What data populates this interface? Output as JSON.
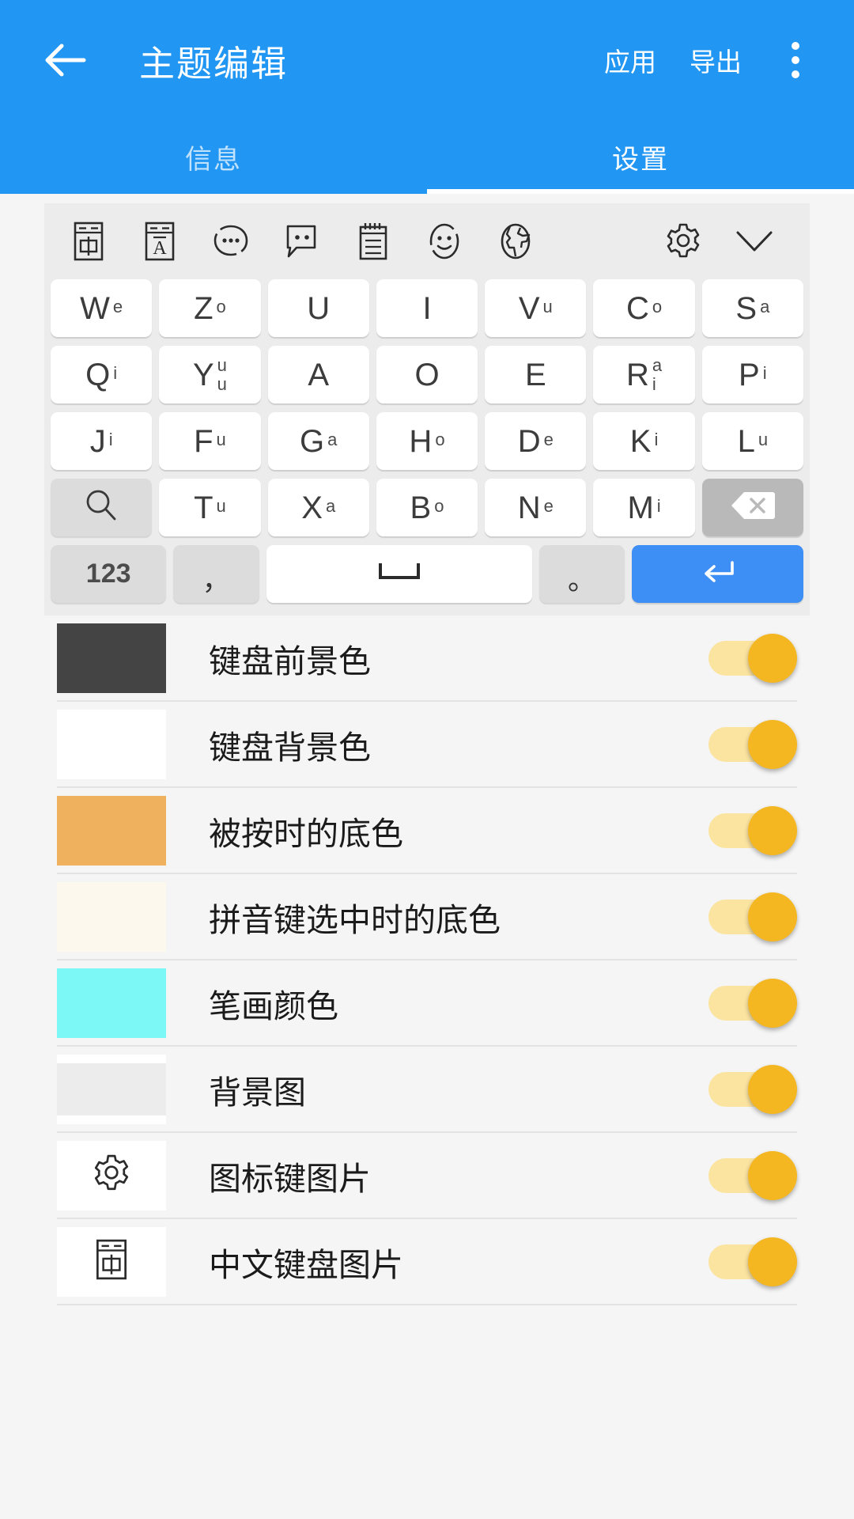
{
  "appbar": {
    "back_icon": "arrow-left-icon",
    "title": "主题编辑",
    "actions": [
      "应用",
      "导出"
    ],
    "apply_label": "应用",
    "export_label": "导出",
    "overflow_icon": "more-vertical-icon",
    "accent_color": "#2196f3"
  },
  "tabs": [
    {
      "label": "信息",
      "active": false
    },
    {
      "label": "设置",
      "active": true
    }
  ],
  "keyboard": {
    "toolbar_left": [
      "chinese-input-icon",
      "latin-input-icon",
      "candidate-bubble-icon",
      "speech-bubble-icon",
      "clipboard-icon",
      "emoji-icon",
      "globe-icon"
    ],
    "toolbar_right": [
      "gear-icon",
      "chevron-down-icon"
    ],
    "rows": [
      [
        {
          "main": "W",
          "sup": [
            "e"
          ]
        },
        {
          "main": "Z",
          "sup": [
            "o"
          ]
        },
        {
          "main": "U",
          "sup": []
        },
        {
          "main": "I",
          "sup": []
        },
        {
          "main": "V",
          "sup": [
            "u"
          ]
        },
        {
          "main": "C",
          "sup": [
            "o"
          ]
        },
        {
          "main": "S",
          "sup": [
            "a"
          ]
        }
      ],
      [
        {
          "main": "Q",
          "sup": [
            "i"
          ]
        },
        {
          "main": "Y",
          "sup": [
            "u",
            "u"
          ]
        },
        {
          "main": "A",
          "sup": []
        },
        {
          "main": "O",
          "sup": []
        },
        {
          "main": "E",
          "sup": []
        },
        {
          "main": "R",
          "sup": [
            "a",
            "i"
          ]
        },
        {
          "main": "P",
          "sup": [
            "i"
          ]
        }
      ],
      [
        {
          "main": "J",
          "sup": [
            "i"
          ]
        },
        {
          "main": "F",
          "sup": [
            "u"
          ]
        },
        {
          "main": "G",
          "sup": [
            "a"
          ]
        },
        {
          "main": "H",
          "sup": [
            "o"
          ]
        },
        {
          "main": "D",
          "sup": [
            "e"
          ]
        },
        {
          "main": "K",
          "sup": [
            "i"
          ]
        },
        {
          "main": "L",
          "sup": [
            "u"
          ]
        }
      ],
      [
        {
          "main": "",
          "sup": [],
          "icon": "search-icon",
          "style": "fn"
        },
        {
          "main": "T",
          "sup": [
            "u"
          ]
        },
        {
          "main": "X",
          "sup": [
            "a"
          ]
        },
        {
          "main": "B",
          "sup": [
            "o"
          ]
        },
        {
          "main": "N",
          "sup": [
            "e"
          ]
        },
        {
          "main": "M",
          "sup": [
            "i"
          ]
        },
        {
          "main": "",
          "sup": [],
          "icon": "backspace-icon",
          "style": "del"
        }
      ]
    ],
    "bottom_row": {
      "num_label": "123",
      "comma_label": "，",
      "space_icon": "space-bar-icon",
      "period_label": "。",
      "enter_icon": "enter-icon"
    }
  },
  "settings": {
    "rows": [
      {
        "label": "键盘前景色",
        "swatch_type": "color",
        "color": "#444444",
        "toggle_on": true
      },
      {
        "label": "键盘背景色",
        "swatch_type": "color",
        "color": "#ffffff",
        "toggle_on": true
      },
      {
        "label": "被按时的底色",
        "swatch_type": "color",
        "color": "#f0b15e",
        "toggle_on": true
      },
      {
        "label": "拼音键选中时的底色",
        "swatch_type": "color",
        "color": "#fdf8ed",
        "toggle_on": true
      },
      {
        "label": "笔画颜色",
        "swatch_type": "color",
        "color": "#7cf9f6",
        "toggle_on": true
      },
      {
        "label": "背景图",
        "swatch_type": "bgimage",
        "color": "#ececec",
        "toggle_on": true
      },
      {
        "label": "图标键图片",
        "swatch_type": "icon",
        "icon": "gear-icon",
        "toggle_on": true
      },
      {
        "label": "中文键盘图片",
        "swatch_type": "icon",
        "icon": "chinese-input-icon",
        "toggle_on": true
      }
    ],
    "toggle_track_color": "#fbe3a0",
    "toggle_knob_color": "#f5b721"
  }
}
